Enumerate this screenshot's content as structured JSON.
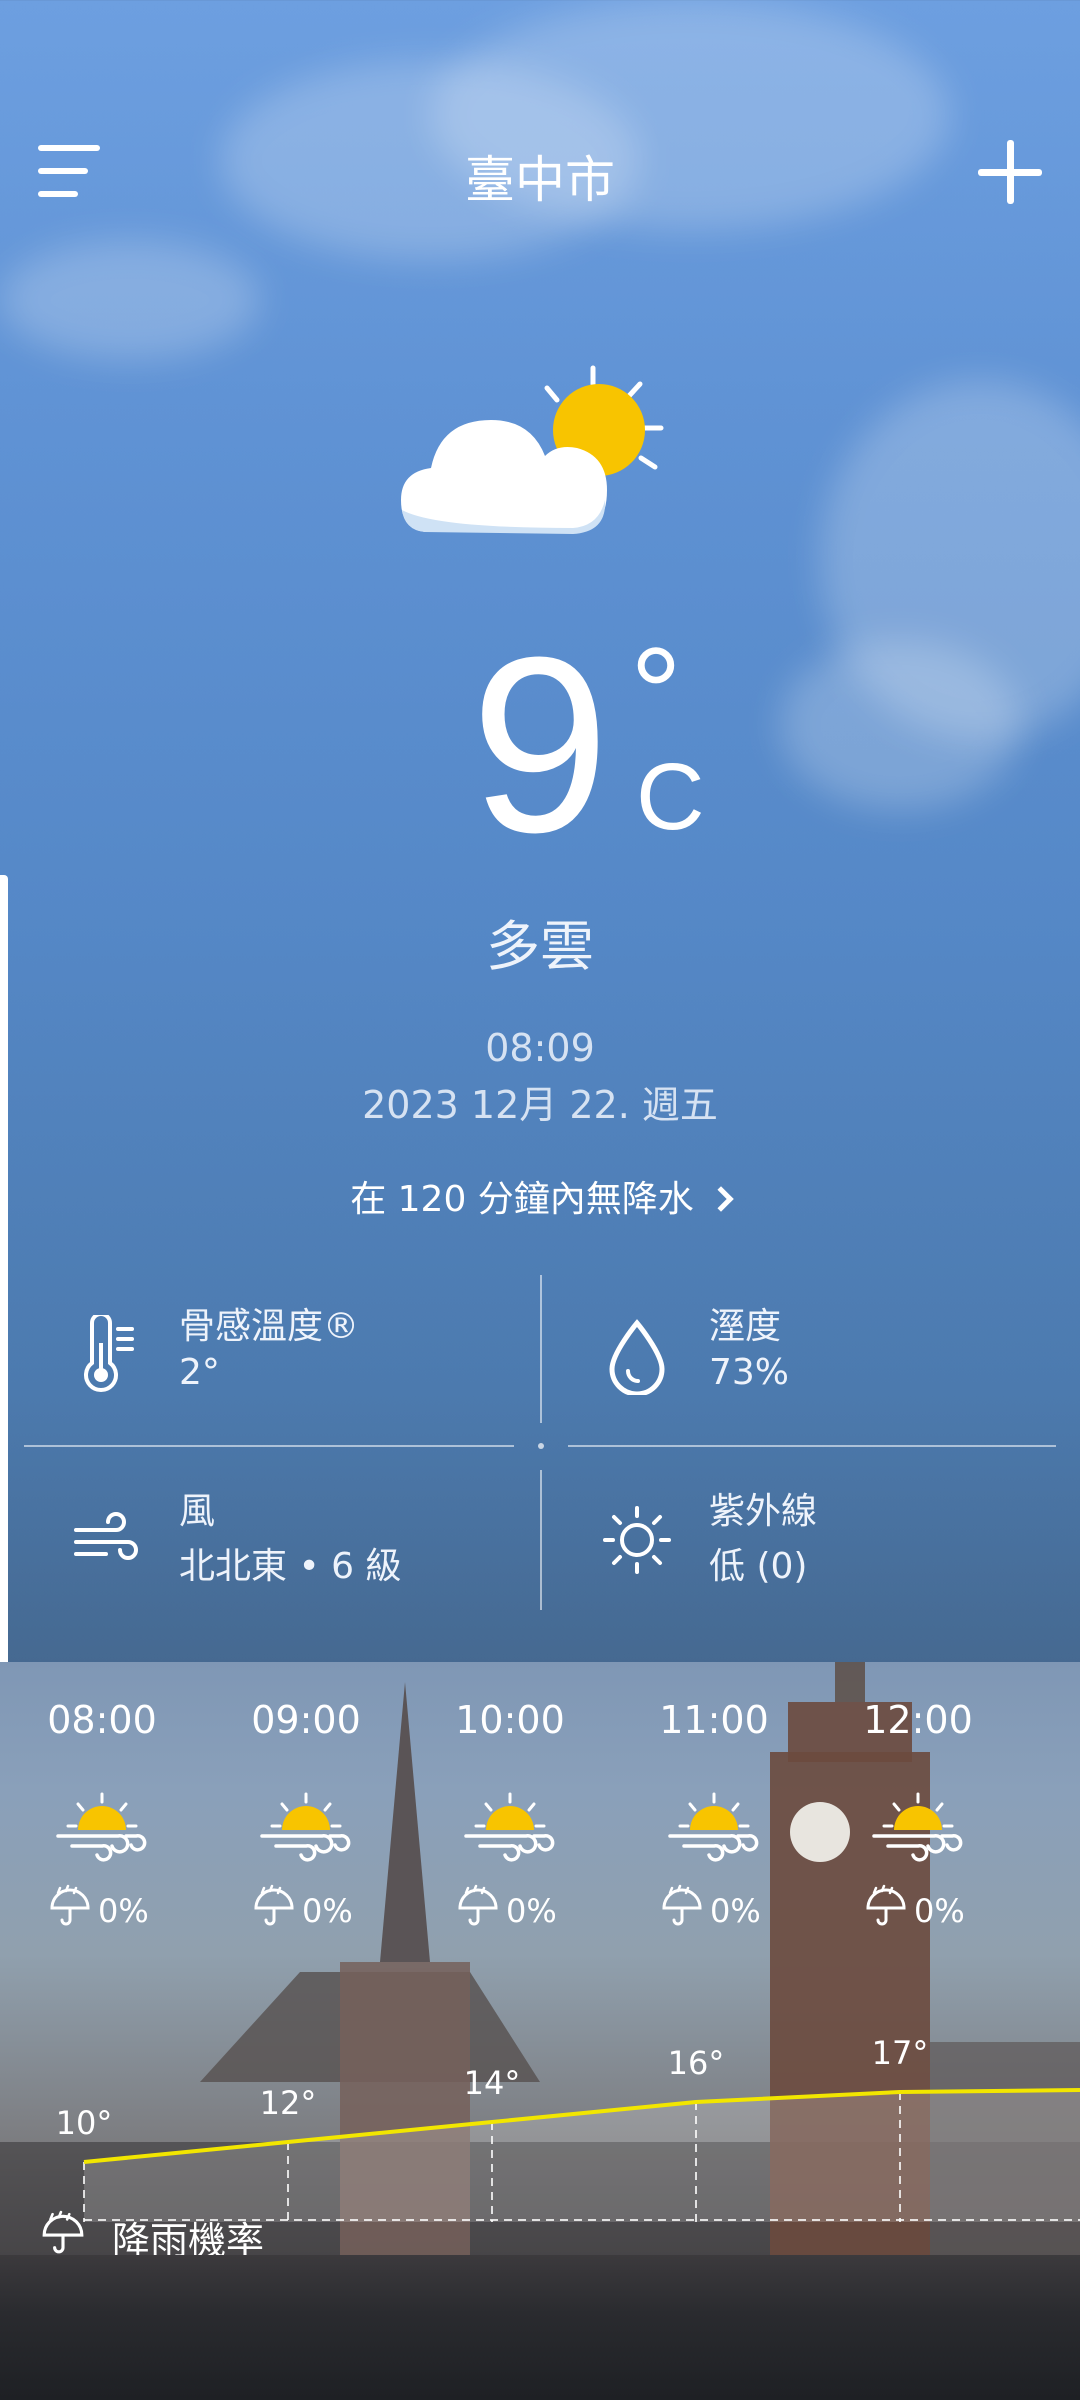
{
  "header": {
    "city": "臺中市"
  },
  "current": {
    "temperature": "9",
    "degree_symbol": "°",
    "unit": "C",
    "condition": "多雲",
    "time": "08:09",
    "date": "2023 12月 22. 週五",
    "precip_forecast": "在 120 分鐘內無降水"
  },
  "details": {
    "feels_like": {
      "label": "骨感溫度®",
      "value": "2°"
    },
    "humidity": {
      "label": "溼度",
      "value": "73%"
    },
    "wind": {
      "label": "風",
      "value": "北北東 • 6 級"
    },
    "uv": {
      "label": "紫外線",
      "value": "低 (0)"
    }
  },
  "hourly": [
    {
      "time": "08:00",
      "rain": "0%",
      "temp": "10°",
      "temp_value": 10
    },
    {
      "time": "09:00",
      "rain": "0%",
      "temp": "12°",
      "temp_value": 12
    },
    {
      "time": "10:00",
      "rain": "0%",
      "temp": "14°",
      "temp_value": 14
    },
    {
      "time": "11:00",
      "rain": "0%",
      "temp": "16°",
      "temp_value": 16
    },
    {
      "time": "12:00",
      "rain": "0%",
      "temp": "17°",
      "temp_value": 17
    }
  ],
  "hourly_footer": {
    "rain_label": "降雨機率"
  },
  "colors": {
    "sun": "#f8c400",
    "temp_line": "#f2e600"
  }
}
